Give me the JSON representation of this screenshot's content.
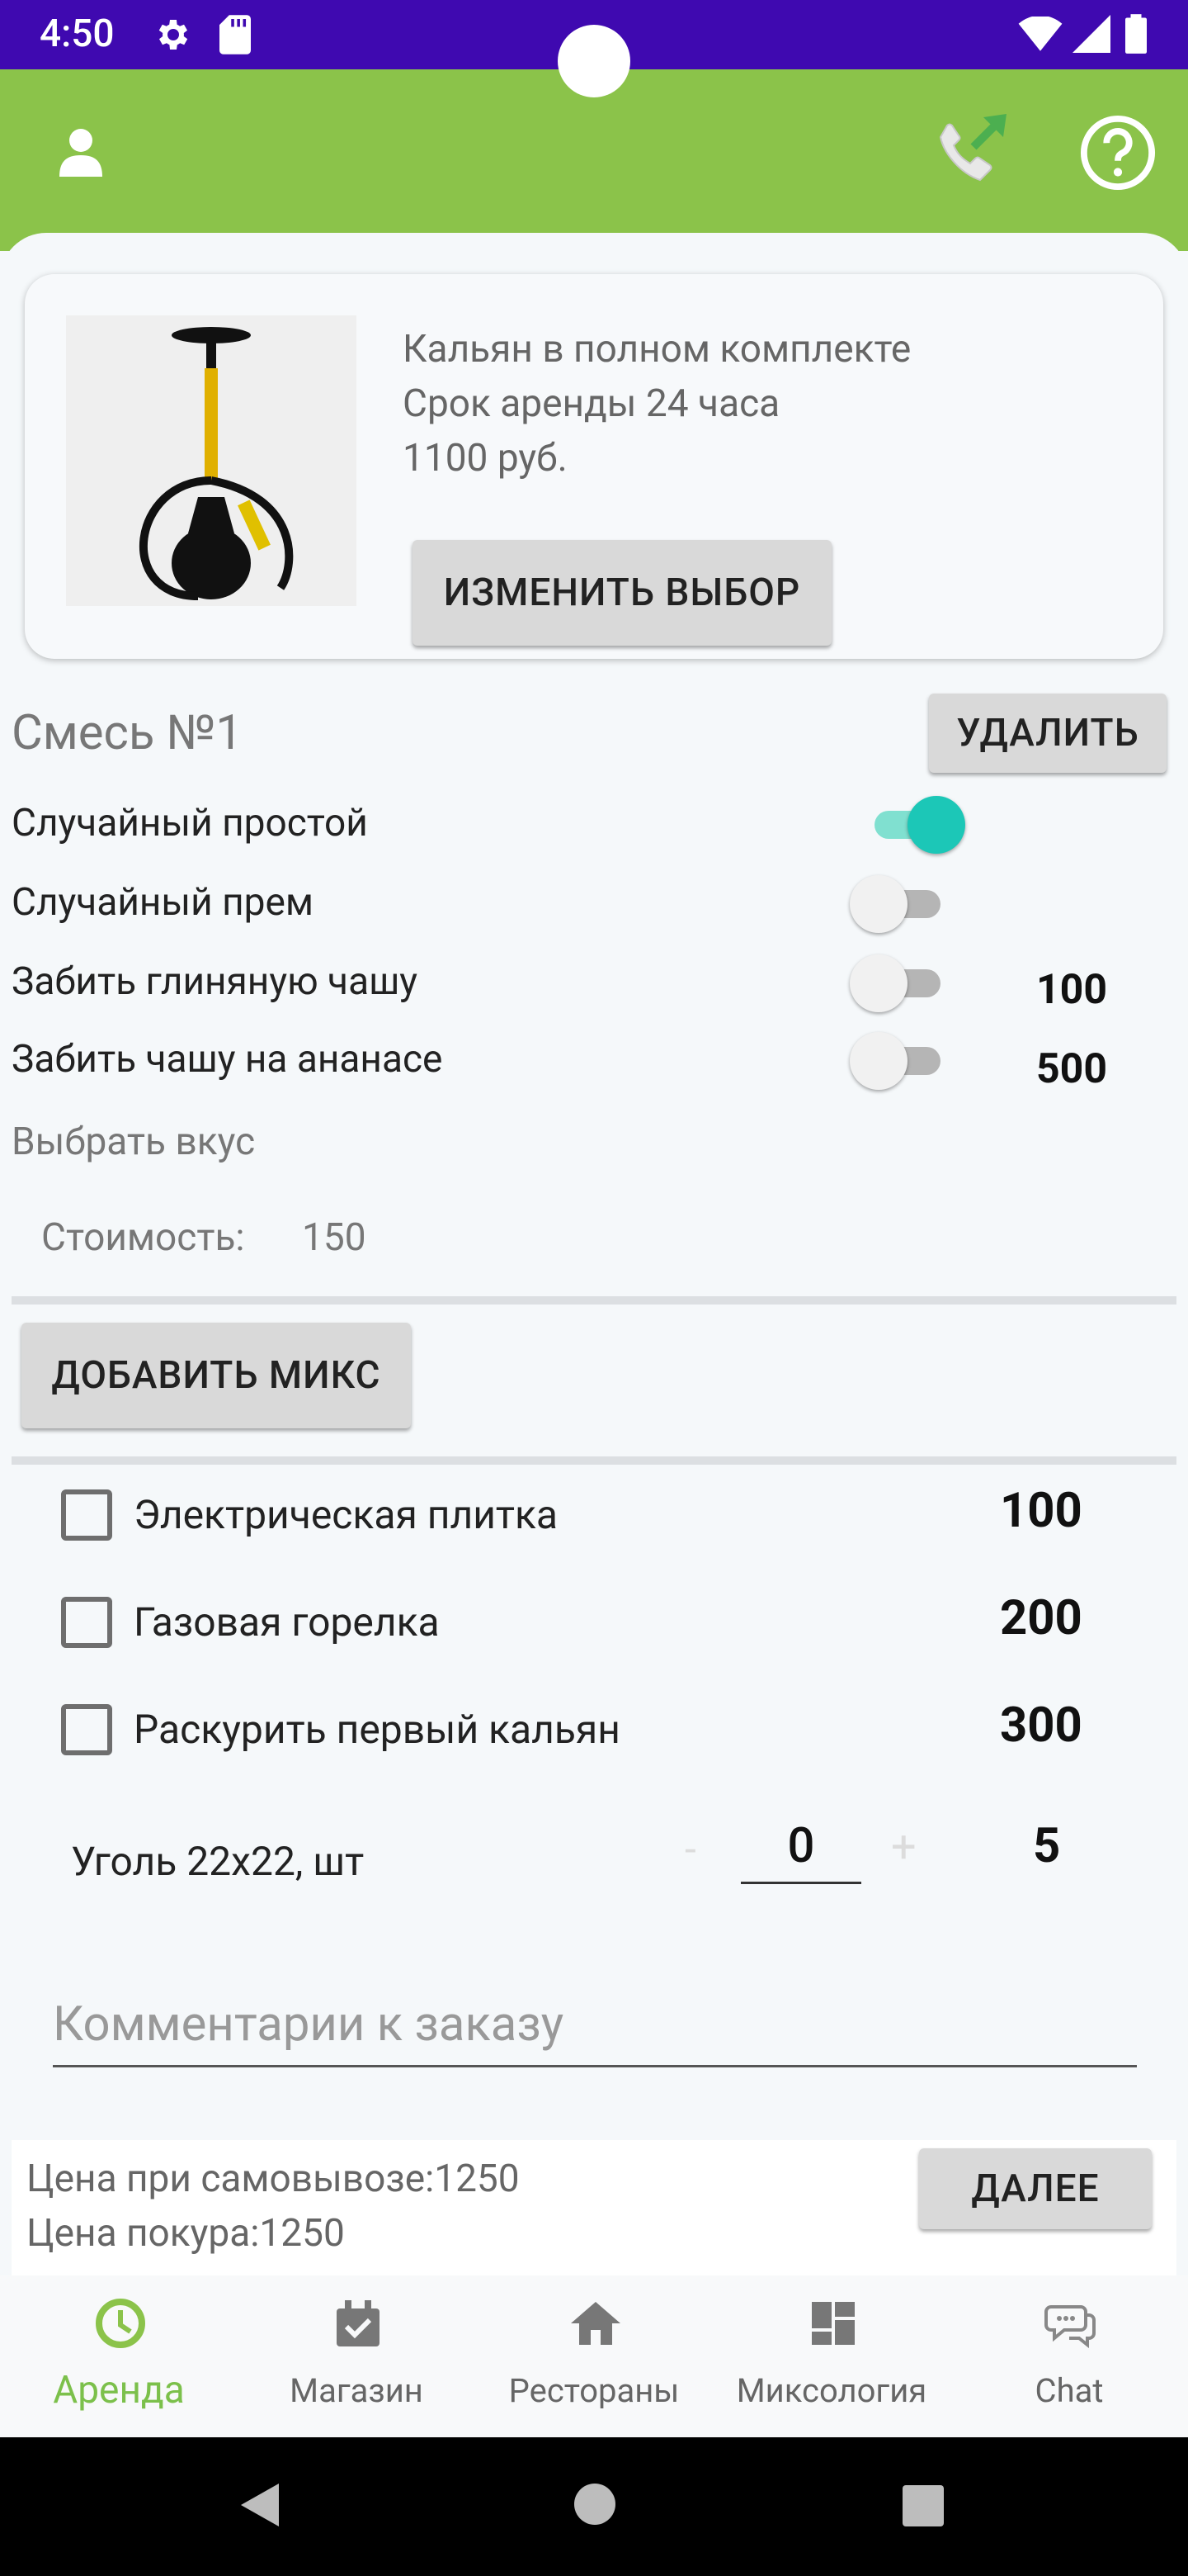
{
  "status_bar": {
    "time": "4:50"
  },
  "product": {
    "line1": "Кальян в полном комплекте",
    "line2": "Срок аренды 24 часа",
    "line3": "1100 руб.",
    "change_button": "ИЗМЕНИТЬ ВЫБОР"
  },
  "mix": {
    "title": "Смесь №1",
    "delete_button": "УДАЛИТЬ",
    "options": [
      {
        "label": "Случайный простой",
        "on": true,
        "price": ""
      },
      {
        "label": "Случайный прем",
        "on": false,
        "price": ""
      },
      {
        "label": "Забить глиняную чашу",
        "on": false,
        "price": "100"
      },
      {
        "label": "Забить чашу на ананасе",
        "on": false,
        "price": "500"
      }
    ],
    "choose_flavor": "Выбрать вкус",
    "cost_label": "Стоимость:",
    "cost_value": "150"
  },
  "add_mix_button": "ДОБАВИТЬ МИКС",
  "extras": [
    {
      "label": "Электрическая плитка",
      "price": "100",
      "checked": false
    },
    {
      "label": "Газовая горелка",
      "price": "200",
      "checked": false
    },
    {
      "label": "Раскурить первый кальян",
      "price": "300",
      "checked": false
    }
  ],
  "coal": {
    "label": "Уголь 22x22, шт",
    "minus": "-",
    "qty": "0",
    "plus": "+",
    "price": "5"
  },
  "comment_placeholder": "Комментарии к заказу",
  "summary": {
    "pickup_price": "Цена при самовывозе:1250",
    "smoke_price": "Цена покура:1250",
    "next_button": "ДАЛЕЕ"
  },
  "bottom_nav": [
    {
      "label": "Аренда",
      "icon": "clock-icon",
      "active": true
    },
    {
      "label": "Магазин",
      "icon": "shop-icon",
      "active": false
    },
    {
      "label": "Рестораны",
      "icon": "home-icon",
      "active": false
    },
    {
      "label": "Миксология",
      "icon": "dashboard-icon",
      "active": false
    },
    {
      "label": "Chat",
      "icon": "chat-icon",
      "active": false
    }
  ],
  "colors": {
    "status_bar": "#3f09b0",
    "app_bar": "#8bc34a",
    "accent_active": "#7cc04b",
    "switch_on": "#1cc7b7"
  }
}
